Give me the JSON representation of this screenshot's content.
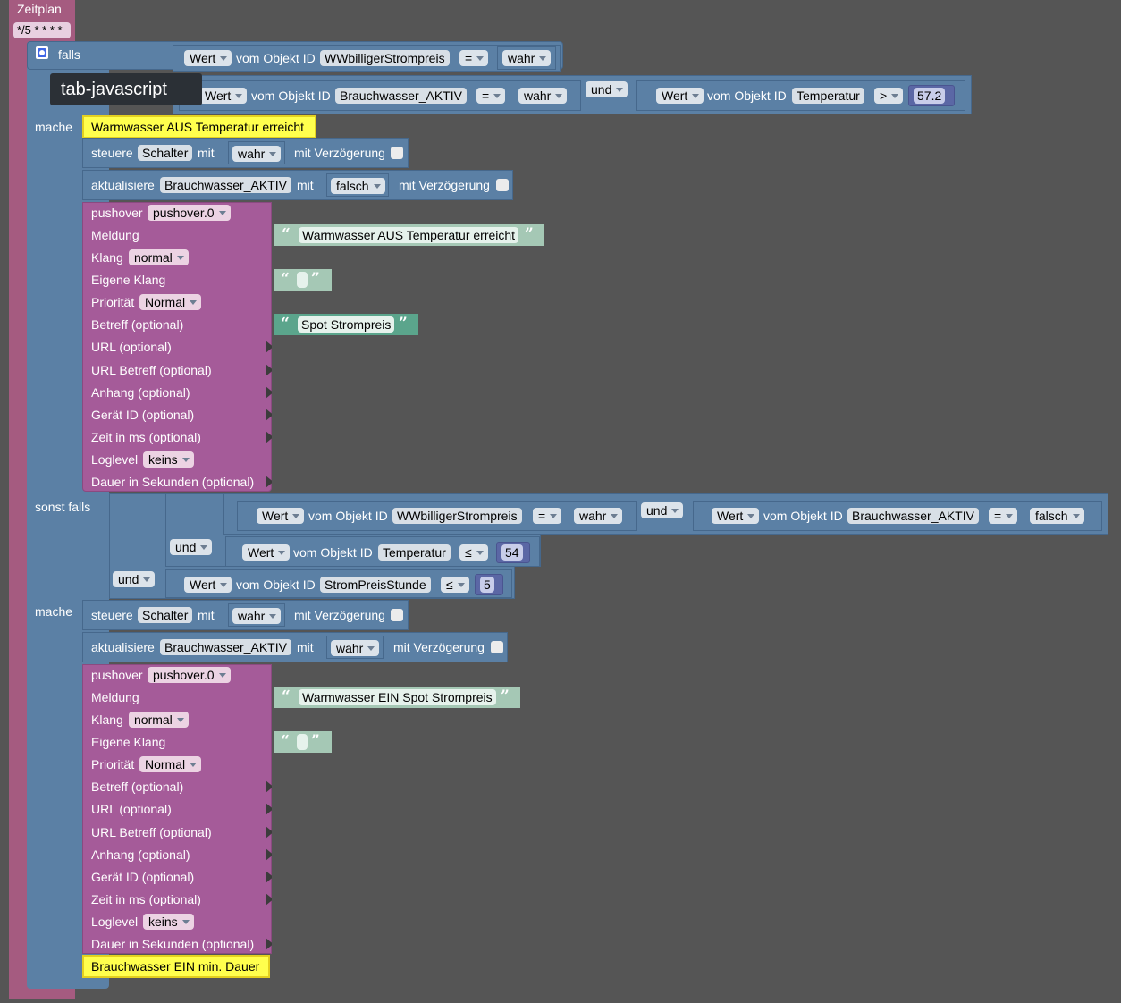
{
  "tooltip": "tab-javascript",
  "trigger": {
    "label": "Zeitplan",
    "cron": "*/5 * * * *"
  },
  "if_block": {
    "falls": "falls",
    "mache": "mache",
    "sonst_falls": "sonst falls",
    "cond1": {
      "wert": "Wert",
      "vom_objekt_id": "vom Objekt ID",
      "object_id": "WWbilligerStrompreis",
      "op": "=",
      "value": "wahr"
    },
    "cond2": {
      "wert": "Wert",
      "vom_objekt_id": "vom Objekt ID",
      "object_id": "Brauchwasser_AKTIV",
      "op": "=",
      "value": "wahr"
    },
    "and1": "und",
    "cond3": {
      "wert": "Wert",
      "vom_objekt_id": "vom Objekt ID",
      "object_id": "Temperatur",
      "op": ">",
      "value": "57.2"
    },
    "comment1": "Warmwasser AUS Temperatur erreicht",
    "steuere1": {
      "steuere": "steuere",
      "object": "Schalter",
      "mit": "mit",
      "value": "wahr",
      "delay": "mit Verzögerung"
    },
    "aktualisiere1": {
      "aktualisiere": "aktualisiere",
      "object": "Brauchwasser_AKTIV",
      "mit": "mit",
      "value": "falsch",
      "delay": "mit Verzögerung"
    },
    "pushover1": {
      "pushover": "pushover",
      "instance": "pushover.0",
      "meldung": "Meldung",
      "meldung_value": "Warmwasser AUS Temperatur erreicht",
      "klang": "Klang",
      "klang_value": "normal",
      "eigene_klang": "Eigene Klang",
      "prioritaet": "Priorität",
      "prioritaet_value": "Normal",
      "betreff": "Betreff (optional)",
      "betreff_value": "Spot Strompreis",
      "url": "URL (optional)",
      "url_betreff": "URL Betreff (optional)",
      "anhang": "Anhang (optional)",
      "geraet": "Gerät ID (optional)",
      "zeit": "Zeit in ms (optional)",
      "loglevel": "Loglevel",
      "loglevel_value": "keins",
      "dauer": "Dauer in Sekunden (optional)"
    },
    "c4": {
      "wert": "Wert",
      "vom_objekt_id": "vom Objekt ID",
      "object_id": "WWbilligerStrompreis",
      "op": "=",
      "value": "wahr"
    },
    "and_top": "und",
    "c5": {
      "wert": "Wert",
      "vom_objekt_id": "vom Objekt ID",
      "object_id": "Brauchwasser_AKTIV",
      "op": "=",
      "value": "falsch"
    },
    "and_mid": "und",
    "c6": {
      "wert": "Wert",
      "vom_objekt_id": "vom Objekt ID",
      "object_id": "Temperatur",
      "op": "≤",
      "value": "54"
    },
    "and_outer": "und",
    "c7": {
      "wert": "Wert",
      "vom_objekt_id": "vom Objekt ID",
      "object_id": "StromPreisStunde",
      "op": "≤",
      "value": "5"
    },
    "mache2": "mache",
    "steuere2": {
      "steuere": "steuere",
      "object": "Schalter",
      "mit": "mit",
      "value": "wahr",
      "delay": "mit Verzögerung"
    },
    "aktualisiere2": {
      "aktualisiere": "aktualisiere",
      "object": "Brauchwasser_AKTIV",
      "mit": "mit",
      "value": "wahr",
      "delay": "mit Verzögerung"
    },
    "pushover2": {
      "pushover": "pushover",
      "instance": "pushover.0",
      "meldung": "Meldung",
      "meldung_value": "Warmwasser EIN Spot Strompreis",
      "klang": "Klang",
      "klang_value": "normal",
      "eigene_klang": "Eigene Klang",
      "prioritaet": "Priorität",
      "prioritaet_value": "Normal",
      "betreff": "Betreff (optional)",
      "url": "URL (optional)",
      "url_betreff": "URL Betreff (optional)",
      "anhang": "Anhang (optional)",
      "geraet": "Gerät ID (optional)",
      "zeit": "Zeit in ms (optional)",
      "loglevel": "Loglevel",
      "loglevel_value": "keins",
      "dauer": "Dauer in Sekunden (optional)"
    },
    "comment2": "Brauchwasser EIN min. Dauer"
  },
  "colors": {
    "workspace": "#555555",
    "logic": "#5b80a5",
    "trigger": "#a55b80",
    "pushover": "#a55b99",
    "text": "#5ba58c",
    "math": "#5b67a5",
    "comment": "#ffff4d"
  }
}
